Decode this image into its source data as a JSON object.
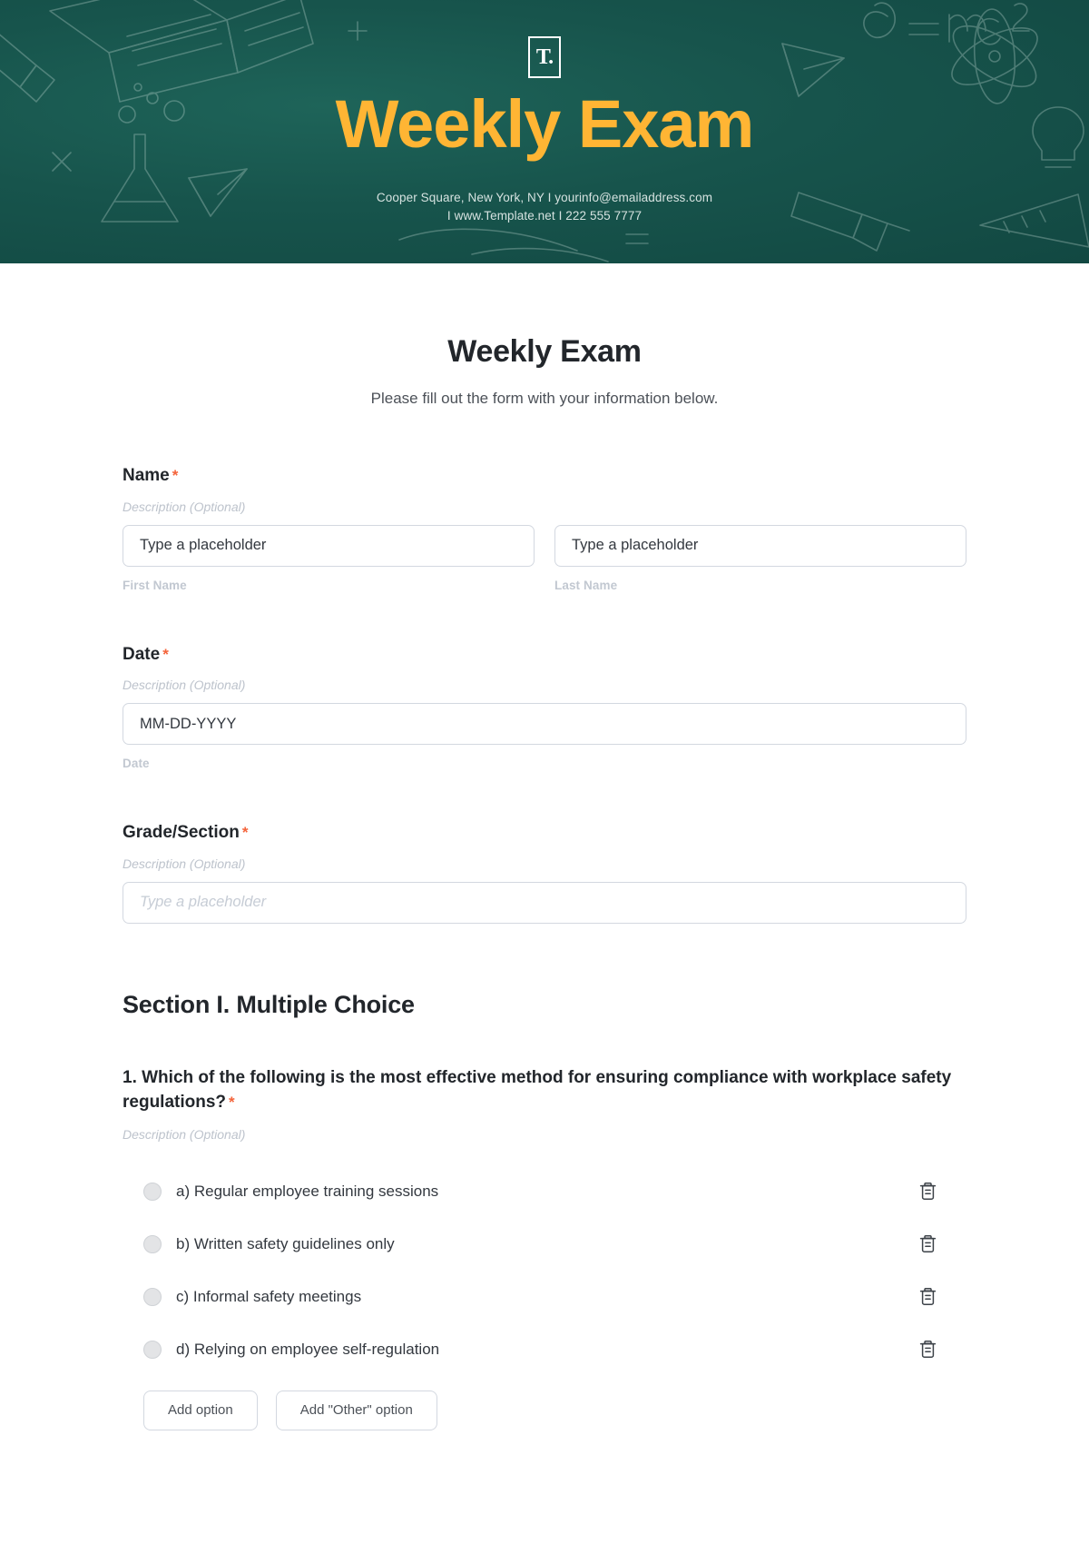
{
  "banner": {
    "logo_mark": "T.",
    "logo_icon": "template-net-logo-icon",
    "title": "Weekly Exam",
    "contact_line1": "Cooper Square, New York, NY  I  yourinfo@emailaddress.com",
    "contact_line2": "I  www.Template.net  I  222 555 7777",
    "bg_color": "#17544c",
    "title_color": "#ffb534"
  },
  "form": {
    "title": "Weekly Exam",
    "subtitle": "Please fill out the form with your information below.",
    "required_marker": "*",
    "description_placeholder": "Description (Optional)"
  },
  "fields": [
    {
      "label": "Name",
      "required": "*",
      "description": "Description (Optional)",
      "inputs": [
        {
          "placeholder": "Type a placeholder",
          "value": "Type a placeholder",
          "sub_label": "First Name"
        },
        {
          "placeholder": "Type a placeholder",
          "value": "Type a placeholder",
          "sub_label": "Last Name"
        }
      ]
    },
    {
      "label": "Date",
      "required": "*",
      "description": "Description (Optional)",
      "inputs": [
        {
          "placeholder": "MM-DD-YYYY",
          "value": "MM-DD-YYYY",
          "sub_label": "Date"
        }
      ]
    },
    {
      "label": "Grade/Section",
      "required": "*",
      "description": "Description (Optional)",
      "inputs": [
        {
          "placeholder": "Type a placeholder",
          "value": "",
          "sub_label": ""
        }
      ]
    }
  ],
  "section": {
    "heading": "Section I. Multiple Choice",
    "question": {
      "text": "1. Which of the following is the most effective method for ensuring compliance with workplace safety regulations?",
      "required": "*",
      "description": "Description (Optional)",
      "options": [
        {
          "label": "a) Regular employee training sessions",
          "delete_icon": "trash-icon"
        },
        {
          "label": "b) Written safety guidelines only",
          "delete_icon": "trash-icon"
        },
        {
          "label": "c) Informal safety meetings",
          "delete_icon": "trash-icon"
        },
        {
          "label": "d) Relying on employee self-regulation",
          "delete_icon": "trash-icon"
        }
      ],
      "add_option_label": "Add option",
      "add_other_label": "Add \"Other\" option"
    }
  },
  "colors": {
    "accent_green": "#17544c",
    "accent_yellow": "#ffb534",
    "required_red": "#f4633a",
    "text_dark": "#22262b",
    "text_muted": "#bdc3cc",
    "border": "#d3d8e0"
  }
}
